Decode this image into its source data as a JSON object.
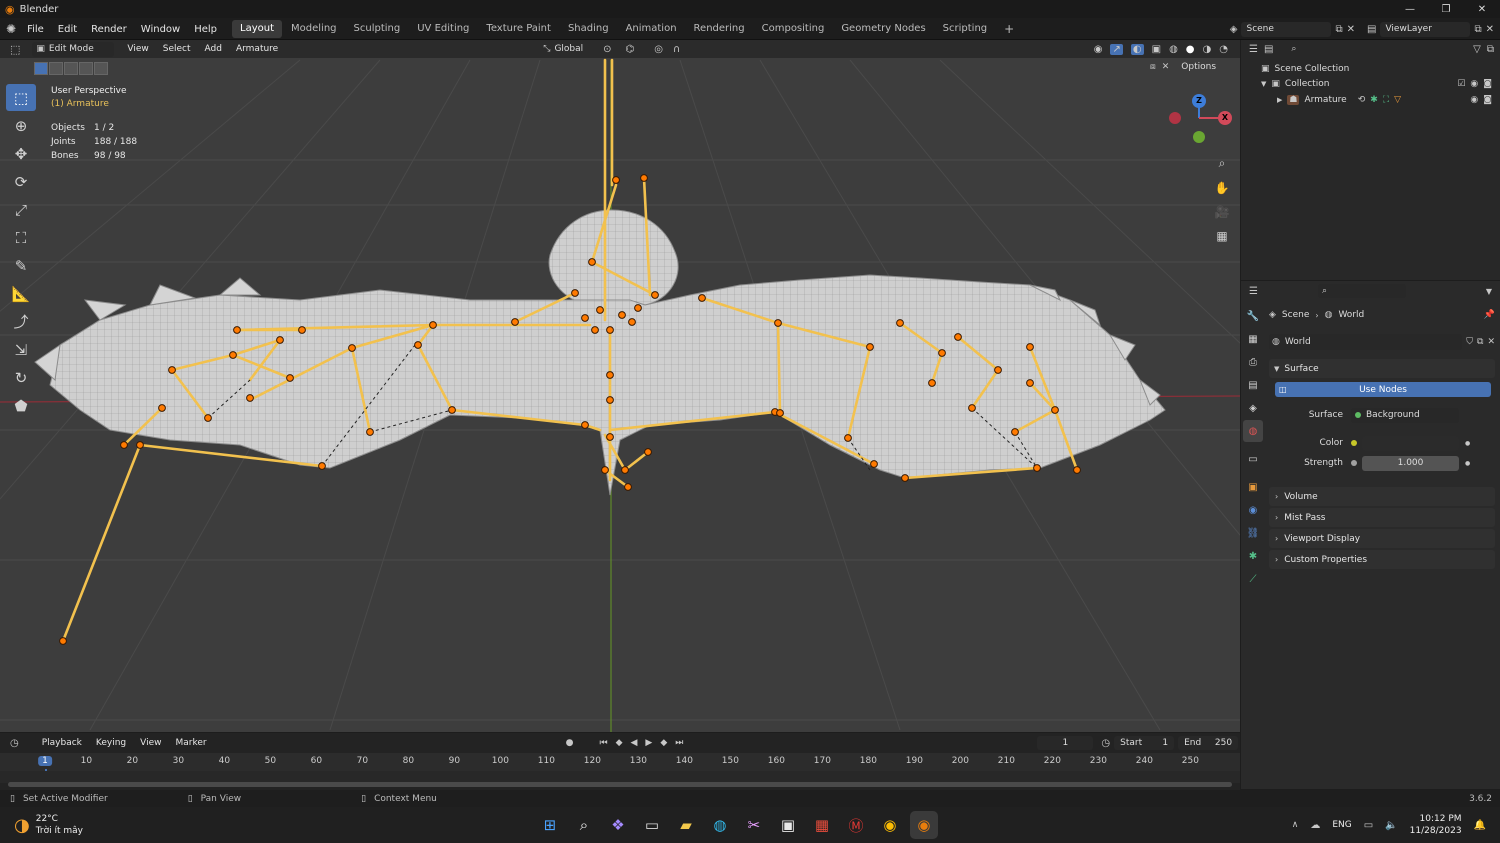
{
  "app": {
    "title": "Blender",
    "version": "3.6.2"
  },
  "window_controls": {
    "minimize": "—",
    "maximize": "❐",
    "close": "✕"
  },
  "menus": [
    "File",
    "Edit",
    "Render",
    "Window",
    "Help"
  ],
  "workspaces": [
    "Layout",
    "Modeling",
    "Sculpting",
    "UV Editing",
    "Texture Paint",
    "Shading",
    "Animation",
    "Rendering",
    "Compositing",
    "Geometry Nodes",
    "Scripting"
  ],
  "active_workspace": "Layout",
  "scene": {
    "name": "Scene",
    "view_layer": "ViewLayer"
  },
  "viewport_header": {
    "mode": "Edit Mode",
    "menus": [
      "View",
      "Select",
      "Add",
      "Armature"
    ],
    "transform_orientation": "Global",
    "options_label": "Options"
  },
  "overlay": {
    "perspective": "User Perspective",
    "object_name": "(1) Armature",
    "stats": [
      {
        "label": "Objects",
        "value": "1 / 2"
      },
      {
        "label": "Joints",
        "value": "188 / 188"
      },
      {
        "label": "Bones",
        "value": "98 / 98"
      }
    ]
  },
  "gizmo_axes": {
    "z": "Z",
    "x": "X"
  },
  "tools": [
    "select-box",
    "cursor",
    "move",
    "rotate",
    "scale",
    "transform",
    "annotate",
    "measure",
    "bone-extrude",
    "bone-size",
    "roll",
    "bone-envelope"
  ],
  "outliner": {
    "search_placeholder": "",
    "items": [
      {
        "label": "Scene Collection"
      },
      {
        "label": "Collection"
      },
      {
        "label": "Armature"
      }
    ]
  },
  "properties": {
    "breadcrumb": [
      "Scene",
      "World"
    ],
    "world_name": "World",
    "surface_label": "Surface",
    "use_nodes": "Use Nodes",
    "surface_field_label": "Surface",
    "surface_value": "Background",
    "color_label": "Color",
    "strength_label": "Strength",
    "strength_value": "1.000",
    "collapsed_panels": [
      "Volume",
      "Mist Pass",
      "Viewport Display",
      "Custom Properties"
    ],
    "colors": {
      "accent": "#4772b3",
      "color_swatch": "#2b2b2b"
    }
  },
  "timeline": {
    "menus": [
      "Playback",
      "Keying",
      "View",
      "Marker"
    ],
    "current_frame": "1",
    "start_label": "Start",
    "start": "1",
    "end_label": "End",
    "end": "250",
    "ticks": [
      "1",
      "10",
      "20",
      "30",
      "40",
      "50",
      "60",
      "70",
      "80",
      "90",
      "100",
      "110",
      "120",
      "130",
      "140",
      "150",
      "160",
      "170",
      "180",
      "190",
      "200",
      "210",
      "220",
      "230",
      "240",
      "250"
    ]
  },
  "status_bar": [
    "Set Active Modifier",
    "Pan View",
    "Context Menu"
  ],
  "taskbar": {
    "weather_temp": "22°C",
    "weather_desc": "Trời ít mây",
    "lang": "ENG",
    "time": "10:12 PM",
    "date": "11/28/2023"
  }
}
